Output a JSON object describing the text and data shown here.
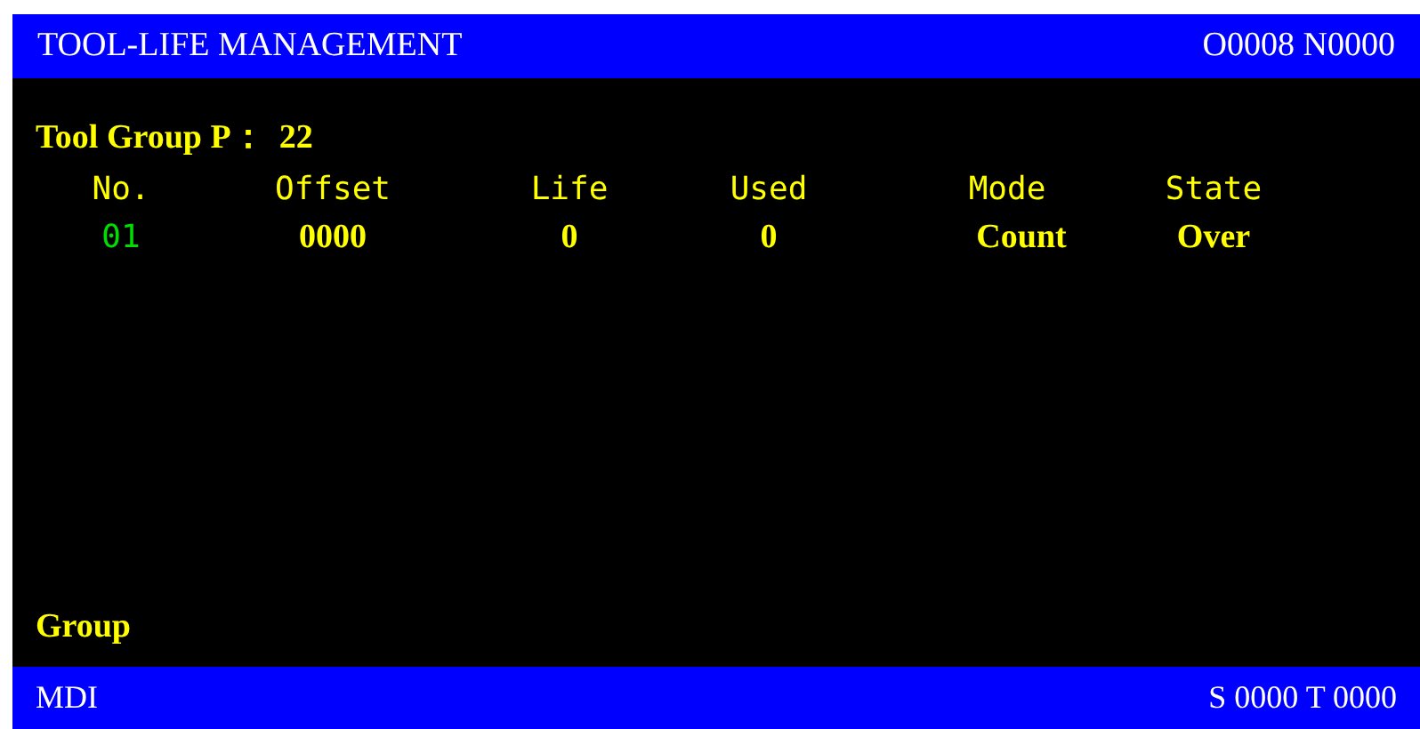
{
  "title_bar": {
    "title": "TOOL-LIFE MANAGEMENT",
    "program": "O0008 N0000"
  },
  "tool_group": {
    "label": "Tool Group P：",
    "value": "22"
  },
  "table": {
    "columns": [
      "No.",
      "Offset",
      "Life",
      "Used",
      "Mode",
      "State"
    ],
    "rows": [
      [
        "01",
        "0000",
        "0",
        "0",
        "Count",
        "Over"
      ]
    ]
  },
  "input_line": "Group",
  "status_bar": {
    "mode": "MDI",
    "spindle_tool": "S 0000 T 0000"
  }
}
